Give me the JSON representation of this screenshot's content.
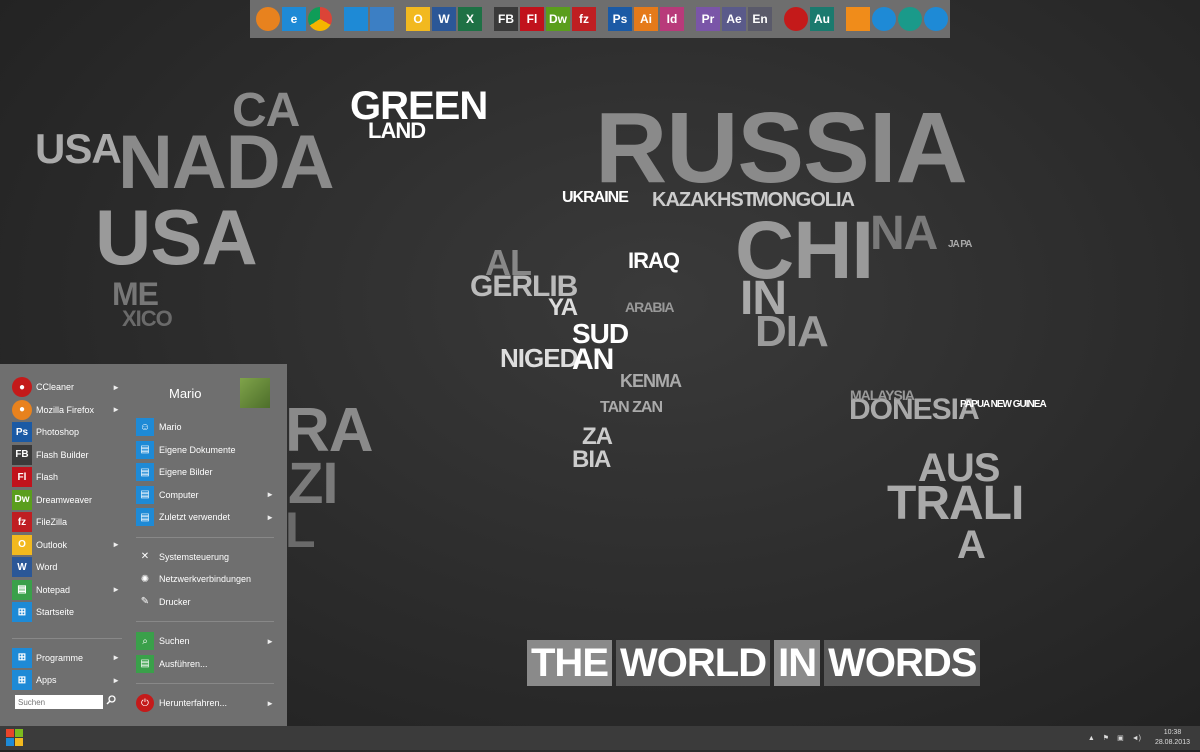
{
  "wallpaper": {
    "banner": [
      "THE",
      "WORLD",
      "IN",
      "WORDS"
    ],
    "words": [
      {
        "t": "CA"
      },
      {
        "t": "USA"
      },
      {
        "t": "NADA"
      },
      {
        "t": "USA"
      },
      {
        "t": "ME"
      },
      {
        "t": "XICO"
      },
      {
        "t": "GREEN"
      },
      {
        "t": "LAND"
      },
      {
        "t": "RUSSIA"
      },
      {
        "t": "KAZAKHST"
      },
      {
        "t": "MONGOLIA"
      },
      {
        "t": "CHI"
      },
      {
        "t": "NA"
      },
      {
        "t": "IN"
      },
      {
        "t": "DIA"
      },
      {
        "t": "UKRAINE"
      },
      {
        "t": "AL"
      },
      {
        "t": "GERLIB"
      },
      {
        "t": "YA"
      },
      {
        "t": "NIGED"
      },
      {
        "t": "SUD"
      },
      {
        "t": "AN"
      },
      {
        "t": "AUS"
      },
      {
        "t": "TRALI"
      },
      {
        "t": "A"
      },
      {
        "t": "DONESIA"
      },
      {
        "t": "IRAQ"
      },
      {
        "t": "ZA"
      },
      {
        "t": "BIA"
      },
      {
        "t": "RA"
      },
      {
        "t": "ZI"
      },
      {
        "t": "L"
      },
      {
        "t": "MALAYSIA"
      },
      {
        "t": "PAPUA NEW GUINEA"
      },
      {
        "t": "JA PA"
      },
      {
        "t": "ARABIA"
      },
      {
        "t": "KENMA"
      },
      {
        "t": "TAN ZAN"
      }
    ]
  },
  "dock": {
    "colors": {
      "orange": "#e8821e",
      "blue": "#1e8ad6",
      "green": "#3aa04a",
      "red": "#d42222",
      "purple": "#7e5aa8"
    },
    "groups": [
      [
        {
          "icon": "firefox-icon",
          "label": "",
          "bg": "#e8821e"
        },
        {
          "icon": "ie-icon",
          "label": "e",
          "bg": "#1e8ad6"
        },
        {
          "icon": "chrome-icon",
          "label": "",
          "bg": "#f0f0f0"
        }
      ],
      [
        {
          "icon": "remote-icon",
          "label": "",
          "bg": "#1e8ad6"
        },
        {
          "icon": "calculator-icon",
          "label": "",
          "bg": "#3c7fc4"
        }
      ],
      [
        {
          "icon": "outlook-icon",
          "label": "O",
          "bg": "#f2b91f"
        },
        {
          "icon": "word-icon",
          "label": "W",
          "bg": "#2b5797"
        },
        {
          "icon": "excel-icon",
          "label": "X",
          "bg": "#1e7145"
        }
      ],
      [
        {
          "icon": "flash-builder-icon",
          "label": "FB",
          "bg": "#3a3a3a"
        },
        {
          "icon": "flash-icon",
          "label": "Fl",
          "bg": "#c1121c"
        },
        {
          "icon": "dreamweaver-icon",
          "label": "Dw",
          "bg": "#5a9e1d"
        },
        {
          "icon": "filezilla-icon",
          "label": "fz",
          "bg": "#bf1e22"
        }
      ],
      [
        {
          "icon": "photoshop-icon",
          "label": "Ps",
          "bg": "#1b5aa5"
        },
        {
          "icon": "illustrator-icon",
          "label": "Ai",
          "bg": "#e57a1a"
        },
        {
          "icon": "indesign-icon",
          "label": "Id",
          "bg": "#b83a7a"
        }
      ],
      [
        {
          "icon": "premiere-icon",
          "label": "Pr",
          "bg": "#7a55a8"
        },
        {
          "icon": "after-effects-icon",
          "label": "Ae",
          "bg": "#5a5a8a"
        },
        {
          "icon": "encore-icon",
          "label": "En",
          "bg": "#5a5a6a"
        }
      ],
      [
        {
          "icon": "media-player-icon",
          "label": "",
          "bg": "#c41a1a"
        },
        {
          "icon": "audition-icon",
          "label": "Au",
          "bg": "#1b7a6e"
        }
      ],
      [
        {
          "icon": "vlc-icon",
          "label": "",
          "bg": "#f08c1a"
        },
        {
          "icon": "play-blue-icon",
          "label": "",
          "bg": "#1e8ad6"
        },
        {
          "icon": "play-teal-icon",
          "label": "",
          "bg": "#1a9a8a"
        },
        {
          "icon": "quicktime-icon",
          "label": "",
          "bg": "#1e8ad6"
        }
      ]
    ]
  },
  "start_menu": {
    "user_name": "Mario",
    "search_placeholder": "Suchen",
    "pinned": [
      {
        "label": "CCleaner",
        "icon": "ccleaner-icon",
        "glyph": "",
        "bg": "#c41a1a",
        "arrow": "►"
      },
      {
        "label": "Mozilla Firefox",
        "icon": "firefox-icon",
        "glyph": "",
        "bg": "#e8821e",
        "arrow": "►"
      },
      {
        "label": "Photoshop",
        "icon": "photoshop-icon",
        "glyph": "Ps",
        "bg": "#1b5aa5",
        "arrow": ""
      },
      {
        "label": "Flash Builder",
        "icon": "flash-builder-icon",
        "glyph": "FB",
        "bg": "#3a3a3a",
        "arrow": ""
      },
      {
        "label": "Flash",
        "icon": "flash-icon",
        "glyph": "Fl",
        "bg": "#c1121c",
        "arrow": ""
      },
      {
        "label": "Dreamweaver",
        "icon": "dreamweaver-icon",
        "glyph": "Dw",
        "bg": "#5a9e1d",
        "arrow": ""
      },
      {
        "label": "FileZilla",
        "icon": "filezilla-icon",
        "glyph": "fz",
        "bg": "#bf1e22",
        "arrow": ""
      },
      {
        "label": "Outlook",
        "icon": "outlook-icon",
        "glyph": "O",
        "bg": "#f2b91f",
        "arrow": "►"
      },
      {
        "label": "Word",
        "icon": "word-icon",
        "glyph": "W",
        "bg": "#2b5797",
        "arrow": ""
      },
      {
        "label": "Notepad",
        "icon": "notepad-icon",
        "glyph": "",
        "bg": "#3aa04a",
        "arrow": "►"
      },
      {
        "label": "Startseite",
        "icon": "windows-icon",
        "glyph": "",
        "bg": "#1e8ad6",
        "arrow": ""
      }
    ],
    "bottom": [
      {
        "label": "Programme",
        "icon": "programs-icon",
        "bg": "#1e8ad6",
        "arrow": "►"
      },
      {
        "label": "Apps",
        "icon": "apps-icon",
        "bg": "#1e8ad6",
        "arrow": "►"
      }
    ],
    "right_a": [
      {
        "label": "Mario",
        "icon": "user-icon",
        "bg": "#1e8ad6",
        "arrow": ""
      },
      {
        "label": "Eigene Dokumente",
        "icon": "documents-icon",
        "bg": "#1e8ad6",
        "arrow": ""
      },
      {
        "label": "Eigene Bilder",
        "icon": "pictures-icon",
        "bg": "#1e8ad6",
        "arrow": ""
      },
      {
        "label": "Computer",
        "icon": "computer-icon",
        "bg": "#1e8ad6",
        "arrow": "►"
      },
      {
        "label": "Zuletzt verwendet",
        "icon": "recent-icon",
        "bg": "#1e8ad6",
        "arrow": "►"
      }
    ],
    "right_b": [
      {
        "label": "Systemsteuerung",
        "icon": "control-panel-icon",
        "bg": "transparent",
        "arrow": ""
      },
      {
        "label": "Netzwerkverbindungen",
        "icon": "network-icon",
        "bg": "transparent",
        "arrow": ""
      },
      {
        "label": "Drucker",
        "icon": "printer-icon",
        "bg": "transparent",
        "arrow": ""
      }
    ],
    "right_c": [
      {
        "label": "Suchen",
        "icon": "search-icon",
        "bg": "#3aa04a",
        "arrow": "►"
      },
      {
        "label": "Ausführen...",
        "icon": "run-icon",
        "bg": "#3aa04a",
        "arrow": ""
      }
    ],
    "shutdown": {
      "label": "Herunterfahren...",
      "icon": "power-icon",
      "bg": "#c41a1a",
      "arrow": "►"
    }
  },
  "taskbar": {
    "time": "10:38",
    "date": "28.08.2013"
  }
}
